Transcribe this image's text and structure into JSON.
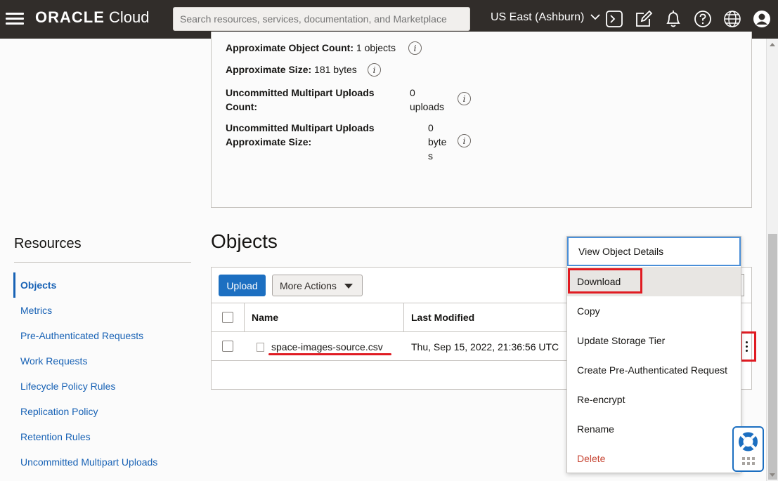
{
  "topbar": {
    "logo_brand": "ORACLE",
    "logo_product": "Cloud",
    "search_placeholder": "Search resources, services, documentation, and Marketplace",
    "region": "US East (Ashburn)",
    "icons": [
      "menu-icon",
      "cloud-shell-icon",
      "edit-icon",
      "bell-icon",
      "help-icon",
      "globe-icon",
      "profile-icon"
    ]
  },
  "bucket_info": {
    "object_count_label": "Approximate Object Count:",
    "object_count_value": "1 objects",
    "size_label": "Approximate Size:",
    "size_value": "181 bytes",
    "mp_count_label_1": "Uncommitted Multipart Uploads",
    "mp_count_label_2": "Count:",
    "mp_count_value_1": "0",
    "mp_count_value_2": "uploads",
    "mp_size_label_1": "Uncommitted Multipart Uploads",
    "mp_size_label_2": "Approximate Size:",
    "mp_size_value_1": "0",
    "mp_size_value_2": "byte",
    "mp_size_value_3": "s",
    "info_glyph": "i"
  },
  "resources": {
    "title": "Resources",
    "items": [
      "Objects",
      "Metrics",
      "Pre-Authenticated Requests",
      "Work Requests",
      "Lifecycle Policy Rules",
      "Replication Policy",
      "Retention Rules",
      "Uncommitted Multipart Uploads"
    ],
    "active": "Objects"
  },
  "objects": {
    "title": "Objects",
    "upload_label": "Upload",
    "more_actions_label": "More Actions",
    "columns": [
      "Name",
      "Last Modified"
    ],
    "rows": [
      {
        "name": "space-images-source.csv",
        "last_modified": "Thu, Sep 15, 2022, 21:36:56 UTC"
      }
    ]
  },
  "context_menu": {
    "items": [
      "View Object Details",
      "Download",
      "Copy",
      "Update Storage Tier",
      "Create Pre-Authenticated Request",
      "Re-encrypt",
      "Rename",
      "Delete"
    ],
    "highlighted": "Download",
    "danger": "Delete"
  },
  "colors": {
    "topbar": "#312d2a",
    "link": "#1862b5",
    "primary_button": "#1c6fc1",
    "annotation_red": "#e01b22",
    "delete_red": "#c74634"
  }
}
